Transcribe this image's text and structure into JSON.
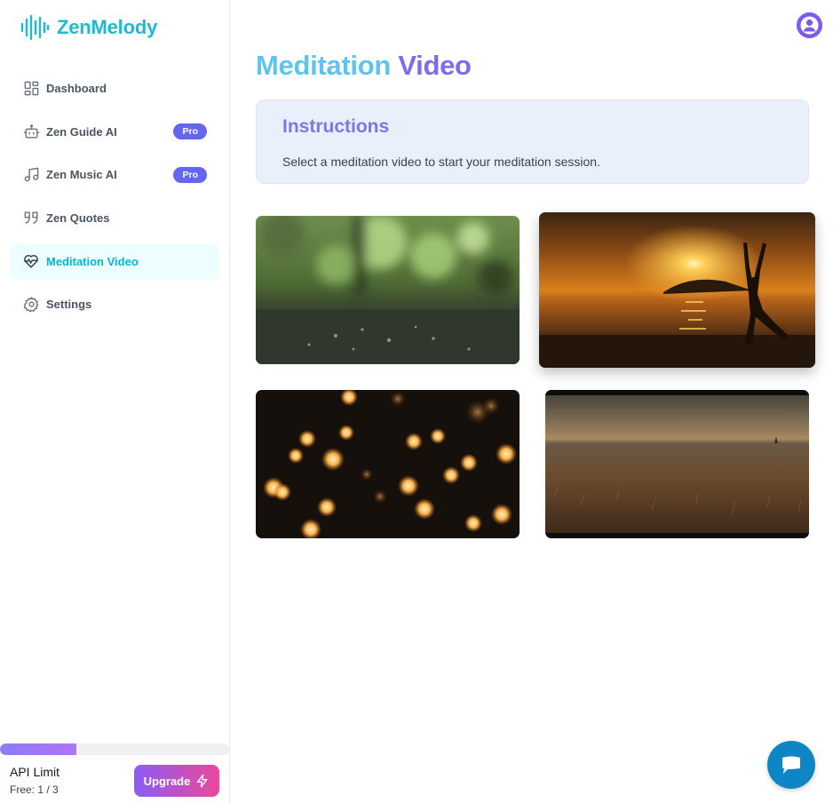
{
  "brand": {
    "name": "ZenMelody",
    "accent": "#22b8cf"
  },
  "sidebar": {
    "items": [
      {
        "label": "Dashboard",
        "icon": "grid-icon",
        "active": false,
        "badge": ""
      },
      {
        "label": "Zen Guide AI",
        "icon": "bot-icon",
        "active": false,
        "badge": "Pro"
      },
      {
        "label": "Zen Music AI",
        "icon": "music-icon",
        "active": false,
        "badge": "Pro"
      },
      {
        "label": "Zen Quotes",
        "icon": "quote-icon",
        "active": false,
        "badge": ""
      },
      {
        "label": "Meditation Video",
        "icon": "heart-pulse-icon",
        "active": true,
        "badge": ""
      },
      {
        "label": "Settings",
        "icon": "gear-icon",
        "active": false,
        "badge": ""
      }
    ]
  },
  "usage": {
    "label": "API Limit",
    "value": "Free: 1 / 3",
    "used": 1,
    "limit": 3
  },
  "upgrade": {
    "label": "Upgrade",
    "icon": "lightning-icon"
  },
  "main": {
    "title_part1": "Meditation",
    "title_part2": "Video",
    "instructions": {
      "heading": "Instructions",
      "text": "Select a meditation video to start your meditation session."
    },
    "videos": [
      {
        "scene": "rain-forest"
      },
      {
        "scene": "beach-sunset-yoga"
      },
      {
        "scene": "candle-bokeh"
      },
      {
        "scene": "field-dusk"
      }
    ]
  },
  "user": {
    "icon": "user-avatar-icon"
  },
  "chat": {
    "icon": "chat-icon"
  },
  "colors": {
    "active_bg": "#ecfeff",
    "active_text": "#06b6d4",
    "pro_badge": "#6366f1",
    "title_blue": "#5fc3f0",
    "title_purple": "#7b6cf0"
  }
}
